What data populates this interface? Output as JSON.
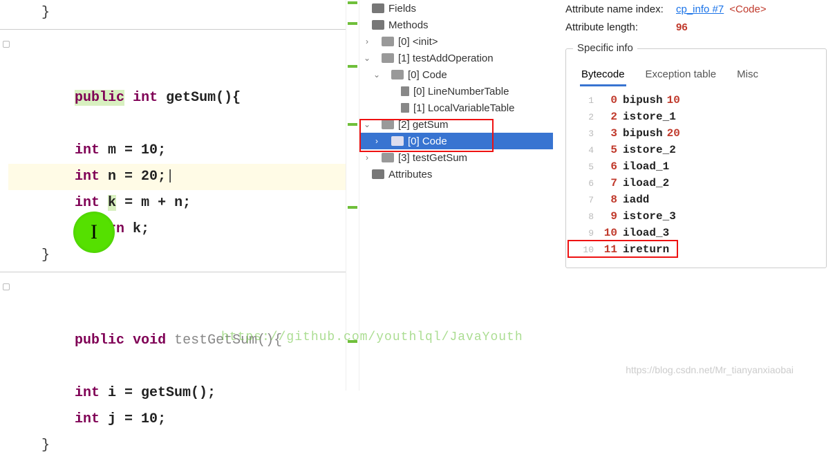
{
  "editor": {
    "l1": "    }",
    "l2a_kw": "public",
    "l2b_kw": "int",
    "l2c": " getSum(){",
    "l3_kw": "int",
    "l3_body": " m = ",
    "l3_num": "10",
    "l3_end": ";",
    "l4_kw": "int",
    "l4_body": " n = ",
    "l4_num": "20",
    "l4_end": ";",
    "l5_kw": "int",
    "l5_hl": "k",
    "l5_rest": " = m + n;",
    "l6_kw": "return",
    "l6_rest": " k;",
    "l7": "    }",
    "l8a_kw": "public",
    "l8b_kw": "void",
    "l8c": " testGetSum(){",
    "l9_kw": "int",
    "l9_rest": " i = getSum();",
    "l10_kw": "int",
    "l10_rest": " j = ",
    "l10_num": "10",
    "l10_end": ";",
    "l11": "    }"
  },
  "watermark": "https://github.com/youthlql/JavaYouth",
  "watermark2": "https://blog.csdn.net/Mr_tianyanxiaobai",
  "tree": {
    "fields": "Fields",
    "methods": "Methods",
    "m0": "[0] <init>",
    "m1": "[1] testAddOperation",
    "m1c": "[0] Code",
    "m1c0": "[0] LineNumberTable",
    "m1c1": "[1] LocalVariableTable",
    "m2": "[2] getSum",
    "m2c": "[0] Code",
    "m3": "[3] testGetSum",
    "attrs": "Attributes"
  },
  "details": {
    "attr_name_label": "Attribute name index:",
    "attr_name_link": "cp_info #7",
    "attr_name_tag": "<Code>",
    "attr_len_label": "Attribute length:",
    "attr_len_val": "96",
    "specific": "Specific info",
    "tabs": {
      "bytecode": "Bytecode",
      "exc": "Exception table",
      "misc": "Misc"
    },
    "bytecode": [
      {
        "ln": "1",
        "off": "0",
        "op": "bipush",
        "arg": "10"
      },
      {
        "ln": "2",
        "off": "2",
        "op": "istore_1",
        "arg": ""
      },
      {
        "ln": "3",
        "off": "3",
        "op": "bipush",
        "arg": "20"
      },
      {
        "ln": "4",
        "off": "5",
        "op": "istore_2",
        "arg": ""
      },
      {
        "ln": "5",
        "off": "6",
        "op": "iload_1",
        "arg": ""
      },
      {
        "ln": "6",
        "off": "7",
        "op": "iload_2",
        "arg": ""
      },
      {
        "ln": "7",
        "off": "8",
        "op": "iadd",
        "arg": ""
      },
      {
        "ln": "8",
        "off": "9",
        "op": "istore_3",
        "arg": ""
      },
      {
        "ln": "9",
        "off": "10",
        "op": "iload_3",
        "arg": ""
      },
      {
        "ln": "10",
        "off": "11",
        "op": "ireturn",
        "arg": ""
      }
    ]
  }
}
